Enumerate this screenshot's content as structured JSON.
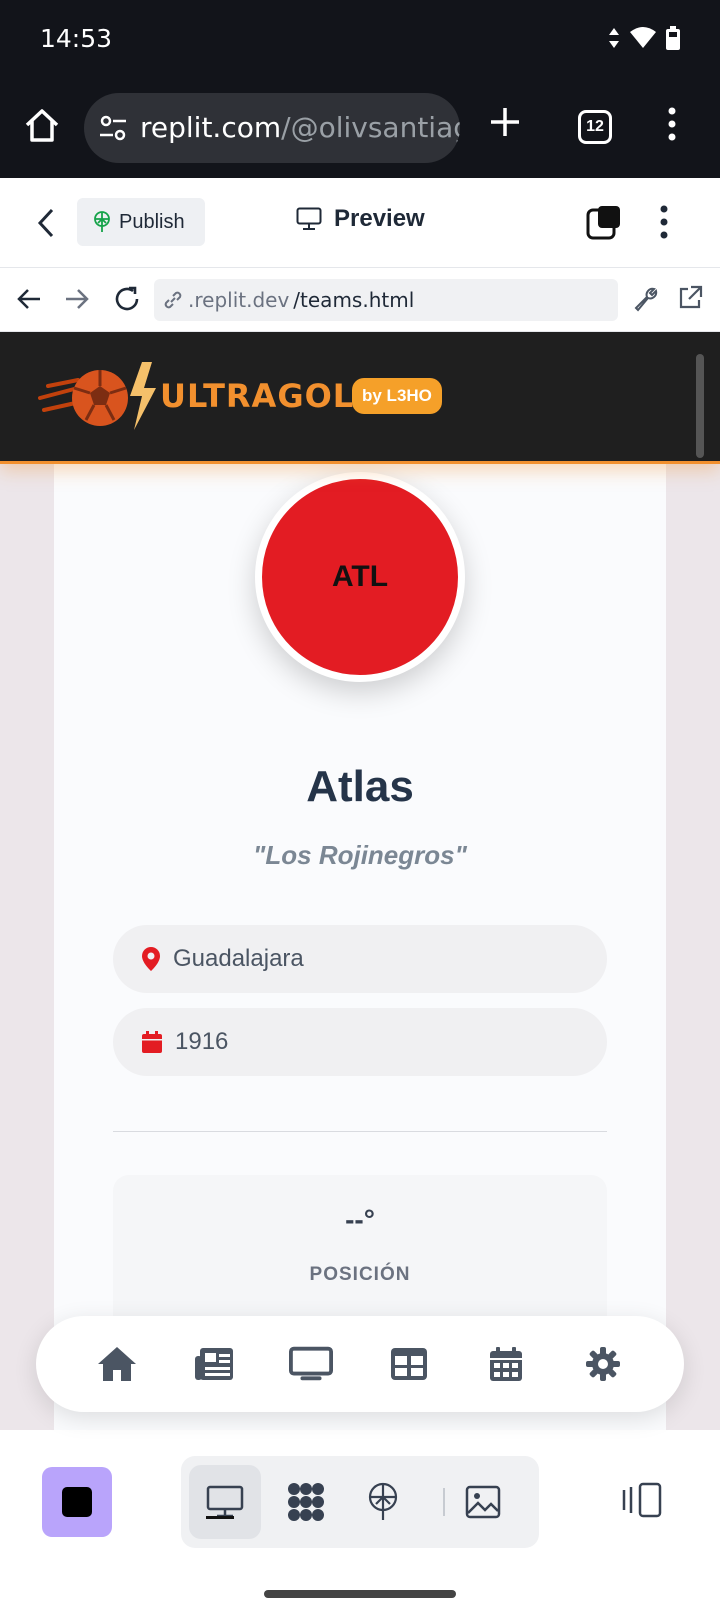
{
  "status": {
    "time": "14:53"
  },
  "browser": {
    "url_host": "replit.com",
    "url_path": "/@olivsantiago",
    "tab_count": "12"
  },
  "replit": {
    "publish_label": "Publish",
    "preview_label": "Preview",
    "address_host": ".replit.dev",
    "address_path": "/teams.html"
  },
  "site": {
    "logo_text": "ULTRAGOL",
    "by_badge": "by L3HO",
    "accent_color": "#f2902e"
  },
  "team": {
    "abbr": "ATL",
    "name": "Atlas",
    "nickname": "\"Los Rojinegros\"",
    "city": "Guadalajara",
    "founded": "1916",
    "color": "#e31c23"
  },
  "stats": {
    "position_value": "--°",
    "position_label": "POSICIÓN"
  },
  "nav_icons": [
    "home-icon",
    "newspaper-icon",
    "tv-icon",
    "table-icon",
    "calendar-icon",
    "settings-icon"
  ]
}
